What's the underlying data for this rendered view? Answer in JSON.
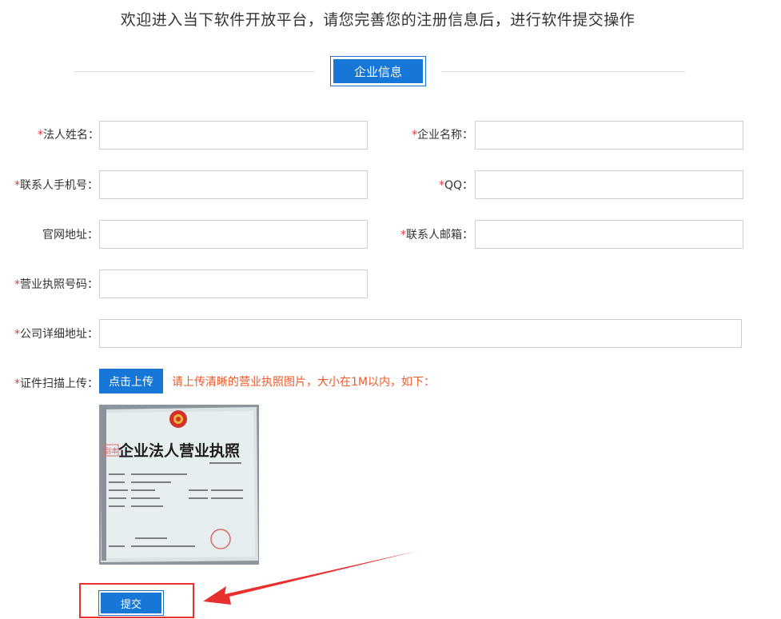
{
  "header": {
    "title": "欢迎进入当下软件开放平台，请您完善您的注册信息后，进行软件提交操作",
    "section_label": "企业信息"
  },
  "form": {
    "required_mark": "*",
    "legal_name_label": "法人姓名：",
    "company_name_label": "企业名称：",
    "contact_phone_label": "联系人手机号：",
    "qq_label": "QQ：",
    "website_label": "官网地址：",
    "contact_email_label": "联系人邮箱：",
    "license_no_label": "营业执照号码：",
    "address_label": "公司详细地址：",
    "upload_label": "证件扫描上传："
  },
  "upload": {
    "button_label": "点击上传",
    "hint": "请上传清晰的营业执照图片，大小在1M以内，如下："
  },
  "sample_license": {
    "heading": "企业法人营业执照",
    "stamp": "副本"
  },
  "submit": {
    "label": "提交"
  },
  "colors": {
    "primary_blue": "#1777d6",
    "required_red": "#e4393c",
    "hint_orange": "#f05a28",
    "annotation_red": "#e8302f"
  }
}
